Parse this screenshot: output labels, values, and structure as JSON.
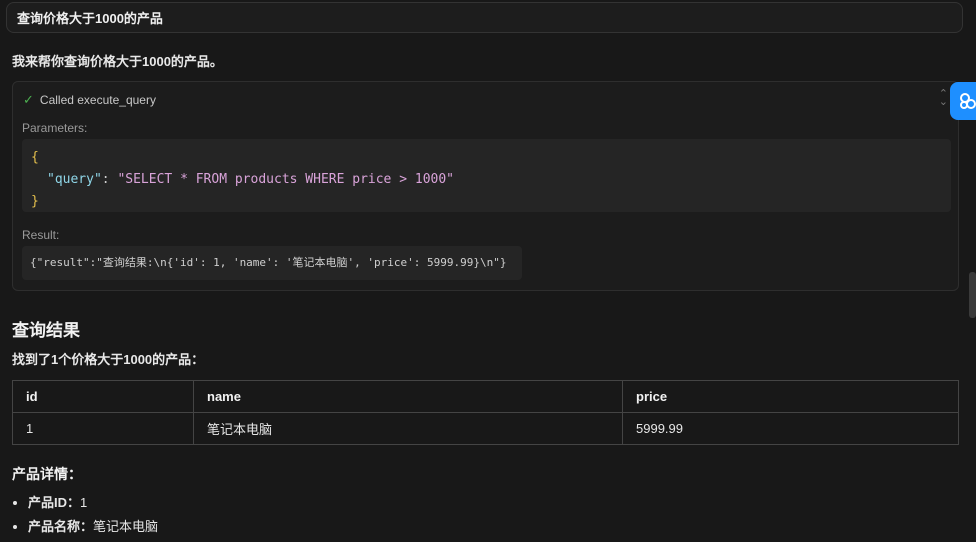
{
  "user_message": "查询价格大于1000的产品",
  "assistant": {
    "intro": "我来帮你查询价格大于1000的产品。",
    "tool_call": {
      "status_icon": "check-icon",
      "title": "Called execute_query",
      "parameters_label": "Parameters:",
      "params": {
        "open": "{",
        "key": "\"query\"",
        "colon": ": ",
        "value": "\"SELECT * FROM products WHERE price > 1000\"",
        "close": "}"
      },
      "result_label": "Result:",
      "result": "{\"result\":\"查询结果:\\n{'id': 1, 'name': '笔记本电脑', 'price': 5999.99}\\n\"}"
    },
    "result_heading": "查询结果",
    "found_text": "找到了1个价格大于1000的产品：",
    "table": {
      "headers": [
        "id",
        "name",
        "price"
      ],
      "rows": [
        [
          "1",
          "笔记本电脑",
          "5999.99"
        ]
      ]
    },
    "details_heading": "产品详情：",
    "details": [
      {
        "label": "产品ID：",
        "value": "1"
      },
      {
        "label": "产品名称：",
        "value": "笔记本电脑"
      }
    ]
  },
  "colors": {
    "background": "#181818",
    "accent": "#1e8fff",
    "success": "#4caf50"
  }
}
